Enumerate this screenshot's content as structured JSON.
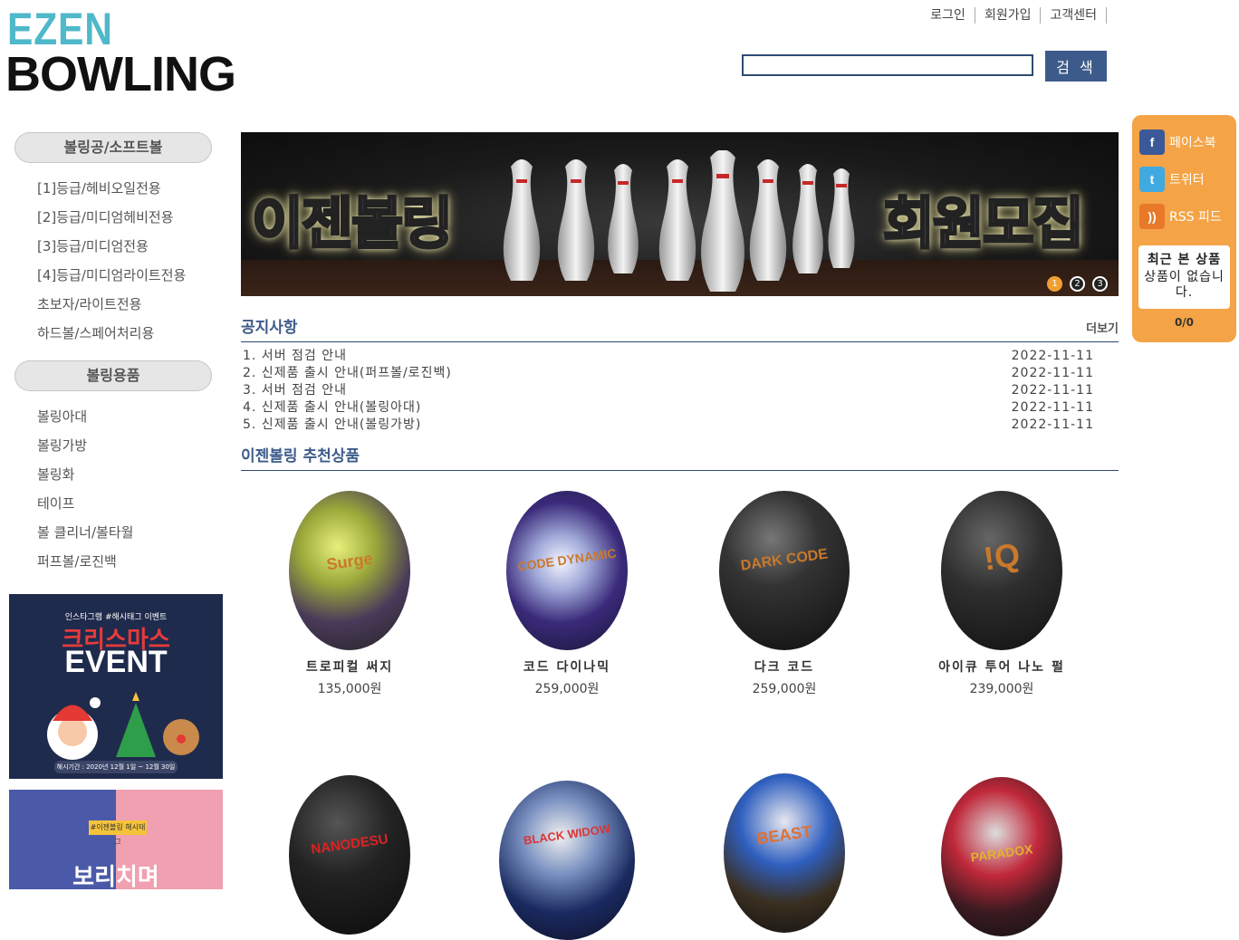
{
  "logo": {
    "line1": "EZEN",
    "line2": "BOWLING"
  },
  "top_links": [
    "로그인",
    "회원가입",
    "고객센터"
  ],
  "search": {
    "button": "검 색",
    "value": ""
  },
  "sidebar": {
    "cat1": {
      "title": "볼링공/소프트볼",
      "items": [
        "[1]등급/헤비오일전용",
        "[2]등급/미디엄헤비전용",
        "[3]등급/미디엄전용",
        "[4]등급/미디엄라이트전용",
        "초보자/라이트전용",
        "하드볼/스페어처리용"
      ]
    },
    "cat2": {
      "title": "볼링용품",
      "items": [
        "볼링아대",
        "볼링가방",
        "볼링화",
        "테이프",
        "볼 클리너/볼타월",
        "퍼프볼/로진백"
      ]
    },
    "ad1": {
      "insta": "인스타그램 #해시태그 이벤트",
      "title": "크리스마스",
      "event": "EVENT",
      "period": "해시기간 : 2020년 12월 1일 ~ 12월 30일"
    },
    "ad2": {
      "tag": "#이젠볼링 해시태그",
      "text": "보리치며"
    }
  },
  "banner": {
    "left_text": "이젠볼링",
    "right_text": "회원모집",
    "slides": [
      "1",
      "2",
      "3"
    ],
    "active_slide": 0
  },
  "notice": {
    "title": "공지사항",
    "more": "더보기",
    "items": [
      {
        "title": "1. 서버 점검 안내",
        "date": "2022-11-11"
      },
      {
        "title": "2. 신제품 출시 안내(퍼프볼/로진백)",
        "date": "2022-11-11"
      },
      {
        "title": "3. 서버 점검 안내",
        "date": "2022-11-11"
      },
      {
        "title": "4. 신제품 출시 안내(볼링아대)",
        "date": "2022-11-11"
      },
      {
        "title": "5. 신제품 출시 안내(볼링가방)",
        "date": "2022-11-11"
      }
    ]
  },
  "recommend": {
    "title": "이젠볼링 추천상품",
    "products": [
      {
        "name": "트로피컬 써지",
        "price": "135,000원",
        "logo": "Surge"
      },
      {
        "name": "코드 다이나믹",
        "price": "259,000원",
        "logo": "CODE DYNAMIC"
      },
      {
        "name": "다크 코드",
        "price": "259,000원",
        "logo": "DARK CODE"
      },
      {
        "name": "아이큐 투어 나노 펄",
        "price": "239,000원",
        "logo": "!Q"
      },
      {
        "name": "",
        "price": "",
        "logo": "NANODESU"
      },
      {
        "name": "",
        "price": "",
        "logo": "BLACK WIDOW"
      },
      {
        "name": "",
        "price": "",
        "logo": "BEAST"
      },
      {
        "name": "",
        "price": "",
        "logo": "PARADOX"
      }
    ]
  },
  "quick_menu": {
    "facebook": "페이스북",
    "twitter": "트위터",
    "rss": "RSS 피드",
    "recent_title": "최근 본 상품",
    "recent_empty": "상품이 없습니다.",
    "pager": "0/0"
  }
}
